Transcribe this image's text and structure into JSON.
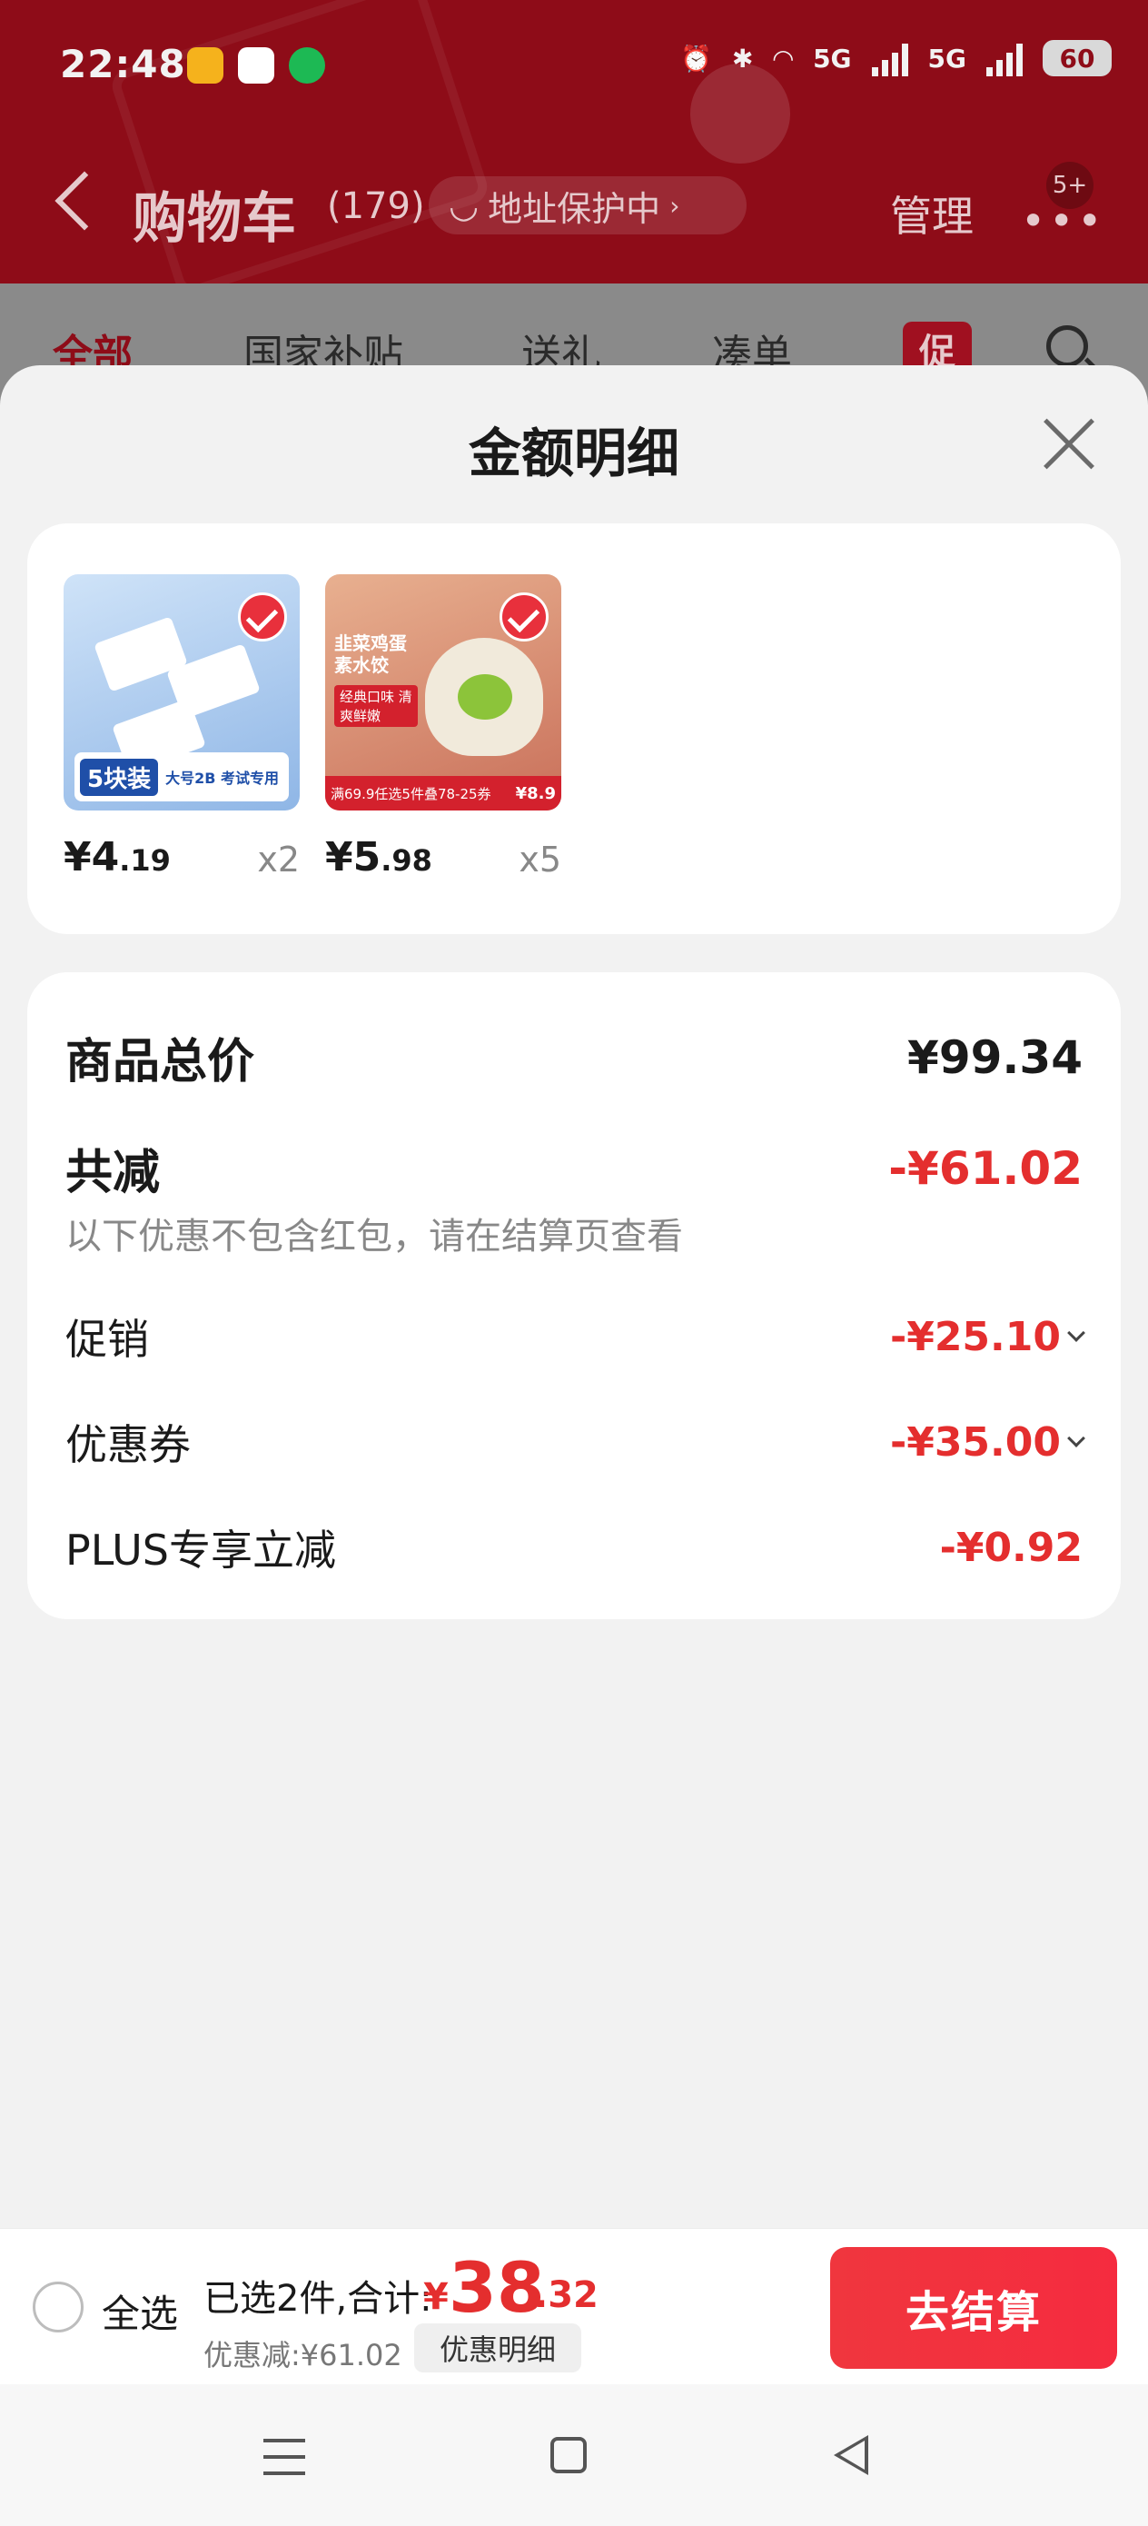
{
  "status": {
    "time": "22:48",
    "network": "5G",
    "battery": "60"
  },
  "nav": {
    "title": "购物车",
    "count": "(179)",
    "address_protect": "地址保护中",
    "manage": "管理",
    "more_badge": "5+"
  },
  "tabs": [
    {
      "label": "全部",
      "active": true
    },
    {
      "label": "国家补贴"
    },
    {
      "label": "送礼"
    },
    {
      "label": "凑单"
    },
    {
      "label": "促"
    }
  ],
  "sheet": {
    "title": "金额明细",
    "products": [
      {
        "name": "eraser",
        "thumb_text": "5块装",
        "thumb_badge": "大号2B 考试专用",
        "price_int": "¥4",
        "price_dec": ".19",
        "qty": "x2"
      },
      {
        "name": "dumplings",
        "thumb_text": "韭菜鸡蛋 素水饺",
        "thumb_badge": "经典口味 清爽鲜嫩",
        "thumb_promo": "满69.9任选5件叠78-25券",
        "thumb_price": "¥8.9",
        "price_int": "¥5",
        "price_dec": ".98",
        "qty": "x5"
      }
    ],
    "summary": {
      "total_label": "商品总价",
      "total_value": "¥99.34",
      "reduce_label": "共减",
      "reduce_value": "-¥61.02",
      "note": "以下优惠不包含红包，请在结算页查看",
      "items": [
        {
          "label": "促销",
          "value": "-¥25.10",
          "expand": true
        },
        {
          "label": "优惠券",
          "value": "-¥35.00",
          "expand": true
        },
        {
          "label": "PLUS专享立减",
          "value": "-¥0.92",
          "expand": false
        }
      ]
    }
  },
  "checkout": {
    "select_all": "全选",
    "selected_text": "已选2件,合计:",
    "total_symbol": "¥",
    "total_int": "38",
    "total_dec": ".32",
    "discount": "优惠减:¥61.02",
    "detail_btn": "优惠明细",
    "go_btn": "去结算"
  },
  "colors": {
    "accent": "#e42e2e",
    "header_bg": "#8e0c18"
  }
}
